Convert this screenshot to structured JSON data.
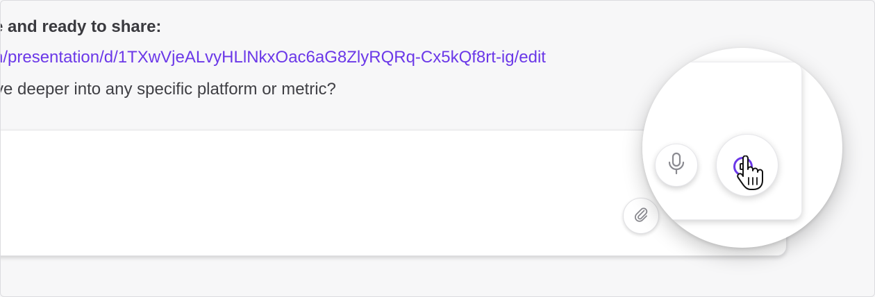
{
  "message": {
    "line1": "e and ready to share:",
    "link": "n/presentation/d/1TXwVjeALvyHLlNkxOac6aG8ZlyRQRq-Cx5kQf8rt-ig/edit",
    "line3": "ve deeper into any specific platform or metric?"
  },
  "composer": {
    "placeholder": ""
  },
  "icons": {
    "attach": "paperclip-icon",
    "mic": "microphone-icon",
    "stop": "stop-icon",
    "cursor": "hand-pointer-icon"
  },
  "colors": {
    "accent": "#6b38e8",
    "link": "#6b38e8",
    "text": "#3f3f44",
    "background": "#f7f7f8"
  }
}
